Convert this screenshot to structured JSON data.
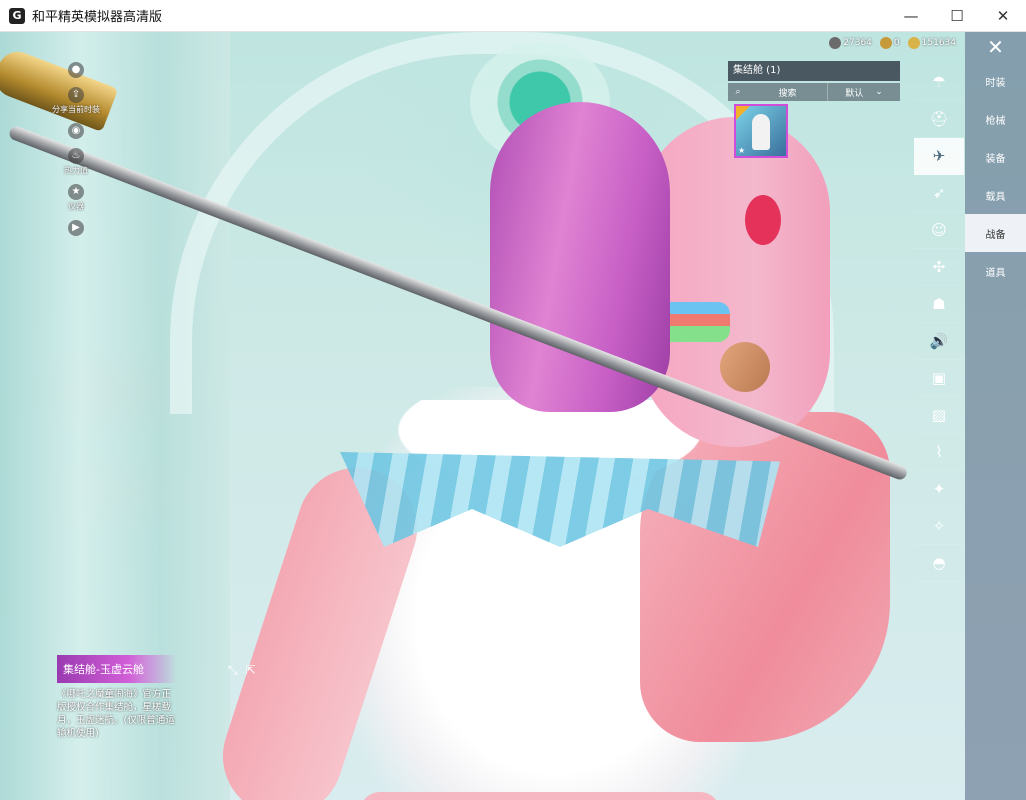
{
  "window": {
    "title": "和平精英模拟器高清版",
    "app_icon": "G",
    "controls": {
      "minimize": "—",
      "maximize": "☐",
      "close": "✕"
    }
  },
  "toolbar": {
    "items": [
      {
        "icon": "camera-icon",
        "glyph": "●",
        "label": ""
      },
      {
        "icon": "share-icon",
        "glyph": "⇪",
        "label": "分享当前时装"
      },
      {
        "icon": "eye-icon",
        "glyph": "◉",
        "label": ""
      },
      {
        "icon": "fire-icon",
        "glyph": "♨",
        "label": "热力值"
      },
      {
        "icon": "badge-icon",
        "glyph": "★",
        "label": "仪器"
      },
      {
        "icon": "video-icon",
        "glyph": "▶",
        "label": ""
      }
    ]
  },
  "currency": [
    {
      "icon": "coin-icon",
      "value": "27364",
      "color": "#6b6b6b"
    },
    {
      "icon": "token-icon",
      "value": "0",
      "color": "#c59a3a"
    },
    {
      "icon": "gold-icon",
      "value": "151634",
      "color": "#d8b34a"
    }
  ],
  "panel": {
    "title": "集结舱 (1)",
    "search_placeholder": "搜索",
    "sort_label": "默认"
  },
  "icon_rail": [
    {
      "icon": "parachute-icon",
      "glyph": "☂"
    },
    {
      "icon": "helmet-icon",
      "glyph": "⛑"
    },
    {
      "icon": "plane-icon",
      "glyph": "✈"
    },
    {
      "icon": "glider-icon",
      "glyph": "➶"
    },
    {
      "icon": "emote-icon",
      "glyph": "☺"
    },
    {
      "icon": "drone-icon",
      "glyph": "✣"
    },
    {
      "icon": "robot-icon",
      "glyph": "☗"
    },
    {
      "icon": "sound-icon",
      "glyph": "🔊"
    },
    {
      "icon": "box-icon",
      "glyph": "▣"
    },
    {
      "icon": "picture-icon",
      "glyph": "▨"
    },
    {
      "icon": "spray-icon",
      "glyph": "⌇"
    },
    {
      "icon": "sparkle-icon",
      "glyph": "✦"
    },
    {
      "icon": "wand-icon",
      "glyph": "✧"
    },
    {
      "icon": "pod-icon",
      "glyph": "◓"
    }
  ],
  "tabs": {
    "close_glyph": "✕",
    "items": [
      "时装",
      "枪械",
      "装备",
      "载具",
      "战备",
      "道具"
    ],
    "active_index": 4
  },
  "item": {
    "name": "集结舱-玉虚云舱",
    "description": "《哪吒之魔童闹海》官方正版授权合作集结舱，星槎载月，玉虚迷航。(仅限普通运输机使用)"
  },
  "mini_icons": [
    {
      "icon": "fullscreen-icon",
      "glyph": "⤡"
    },
    {
      "icon": "export-icon",
      "glyph": "⇱"
    }
  ]
}
